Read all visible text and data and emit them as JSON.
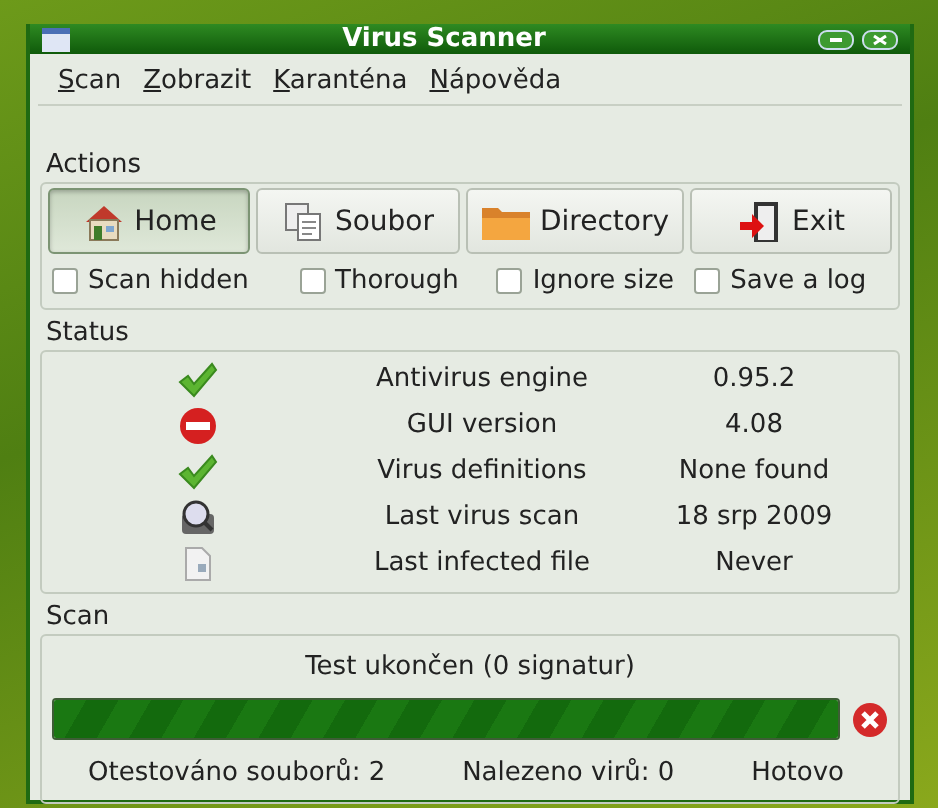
{
  "window": {
    "title": "Virus Scanner"
  },
  "menu": [
    "Scan",
    "Zobrazit",
    "Karanténa",
    "Nápověda"
  ],
  "actions": {
    "label": "Actions",
    "buttons": [
      {
        "label": "Home",
        "kind": "home",
        "selected": true
      },
      {
        "label": "Soubor",
        "kind": "file",
        "selected": false
      },
      {
        "label": "Directory",
        "kind": "folder",
        "selected": false
      },
      {
        "label": "Exit",
        "kind": "exit",
        "selected": false
      }
    ],
    "options": [
      {
        "label": "Scan hidden",
        "checked": false
      },
      {
        "label": "Thorough",
        "checked": false
      },
      {
        "label": "Ignore size",
        "checked": false
      },
      {
        "label": "Save a log",
        "checked": false
      }
    ]
  },
  "status": {
    "label": "Status",
    "rows": [
      {
        "kind": "ok",
        "name": "Antivirus engine",
        "value": "0.95.2"
      },
      {
        "kind": "error",
        "name": "GUI version",
        "value": "4.08"
      },
      {
        "kind": "ok",
        "name": "Virus definitions",
        "value": "None found"
      },
      {
        "kind": "scan",
        "name": "Last virus scan",
        "value": "18 srp 2009"
      },
      {
        "kind": "file",
        "name": "Last infected file",
        "value": "Never"
      }
    ]
  },
  "scan": {
    "label": "Scan",
    "message": "Test ukončen (0 signatur)",
    "level": 1,
    "footer": [
      "Otestováno souborů: 2",
      "Nalezeno virů: 0",
      "Hotovo"
    ]
  }
}
